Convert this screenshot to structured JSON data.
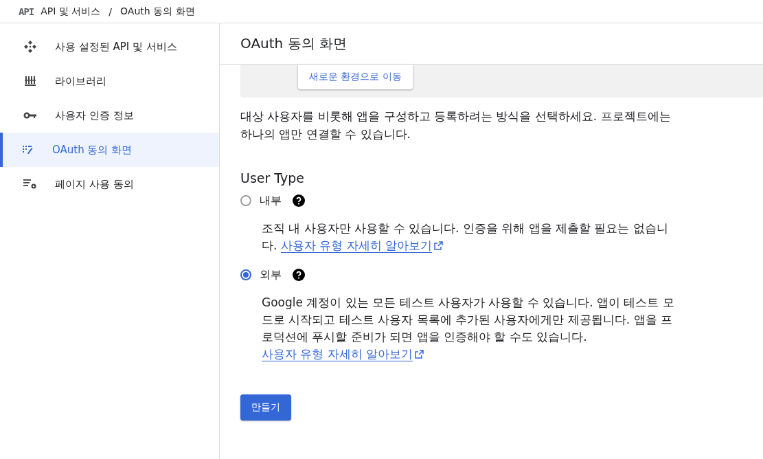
{
  "header": {
    "logo": "API",
    "breadcrumb": [
      "API 및 서비스",
      "OAuth 동의 화면"
    ],
    "separator": "/"
  },
  "sidebar": {
    "items": [
      {
        "label": "사용 설정된 API 및 서비스",
        "selected": false
      },
      {
        "label": "라이브러리",
        "selected": false
      },
      {
        "label": "사용자 인증 정보",
        "selected": false
      },
      {
        "label": "OAuth 동의 화면",
        "selected": true
      },
      {
        "label": "페이지 사용 동의",
        "selected": false
      }
    ]
  },
  "page": {
    "title": "OAuth 동의 화면",
    "banner_button": "새로운 환경으로 이동",
    "intro": "대상 사용자를 비롯해 앱을 구성하고 등록하려는 방식을 선택하세요. 프로젝트에는 하나의 앱만 연결할 수 있습니다.",
    "user_type": {
      "heading": "User Type",
      "options": [
        {
          "label": "내부",
          "selected": false,
          "description": "조직 내 사용자만 사용할 수 있습니다. 인증을 위해 앱을 제출할 필요는 없습니다.",
          "link": "사용자 유형 자세히 알아보기"
        },
        {
          "label": "외부",
          "selected": true,
          "description": "Google 계정이 있는 모든 테스트 사용자가 사용할 수 있습니다. 앱이 테스트 모드로 시작되고 테스트 사용자 목록에 추가된 사용자에게만 제공됩니다. 앱을 프로덕션에 푸시할 준비가 되면 앱을 인증해야 할 수도 있습니다.",
          "link": "사용자 유형 자세히 알아보기"
        }
      ]
    },
    "create_button": "만들기"
  }
}
